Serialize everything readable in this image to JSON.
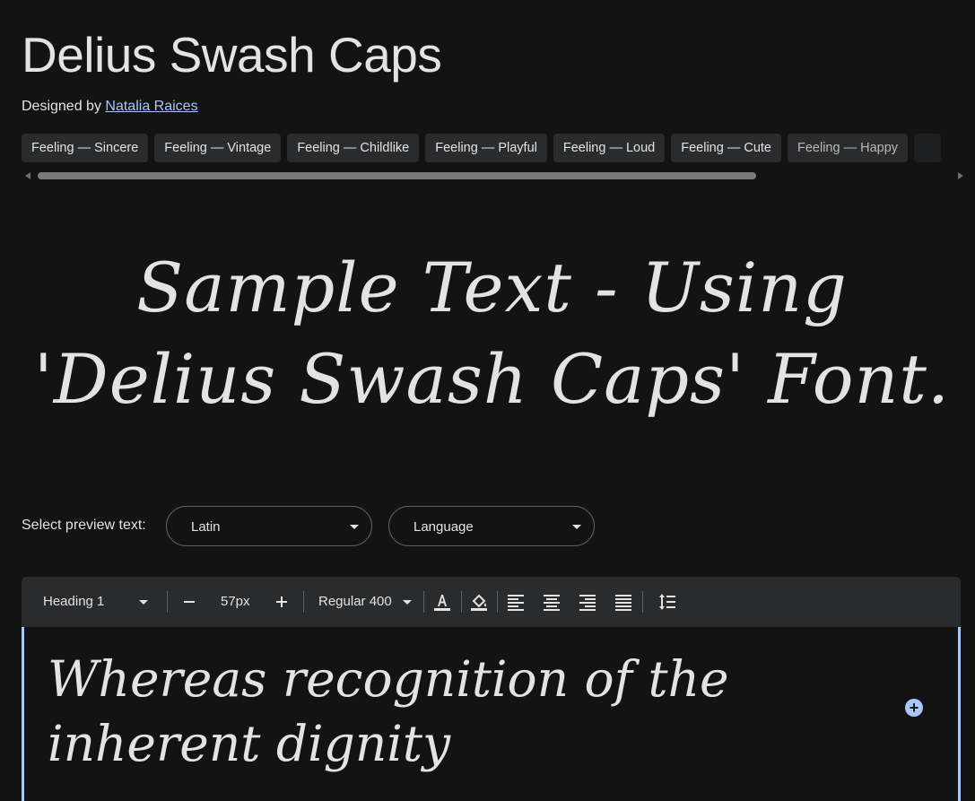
{
  "font_name": "Delius Swash Caps",
  "designer": {
    "prefix": "Designed by",
    "name": "Natalia Raices"
  },
  "tags": [
    "Feeling — Sincere",
    "Feeling — Vintage",
    "Feeling — Childlike",
    "Feeling — Playful",
    "Feeling — Loud",
    "Feeling — Cute",
    "Feeling — Happy"
  ],
  "hero_sample_text": "Sample Text - Using 'Delius Swash Caps' Font.",
  "preview": {
    "label": "Select preview text:",
    "script_select": "Latin",
    "language_select": "Language"
  },
  "toolbar": {
    "style_select": "Heading 1",
    "decrease_icon": "minus-icon",
    "size_value": "57px",
    "increase_icon": "plus-icon",
    "weight_select": "Regular 400",
    "text_color_icon": "text-color-icon",
    "highlight_icon": "fill-color-icon",
    "align_left_icon": "align-left-icon",
    "align_center_icon": "align-center-icon",
    "align_right_icon": "align-right-icon",
    "align_justify_icon": "align-justify-icon",
    "line_height_icon": "line-height-icon"
  },
  "editor_text": "Whereas recognition of the inherent dignity",
  "colors": {
    "background": "#131314",
    "chip_background": "#2a2b2d",
    "link": "#a8c7fa",
    "accent": "#a8c7fa"
  }
}
